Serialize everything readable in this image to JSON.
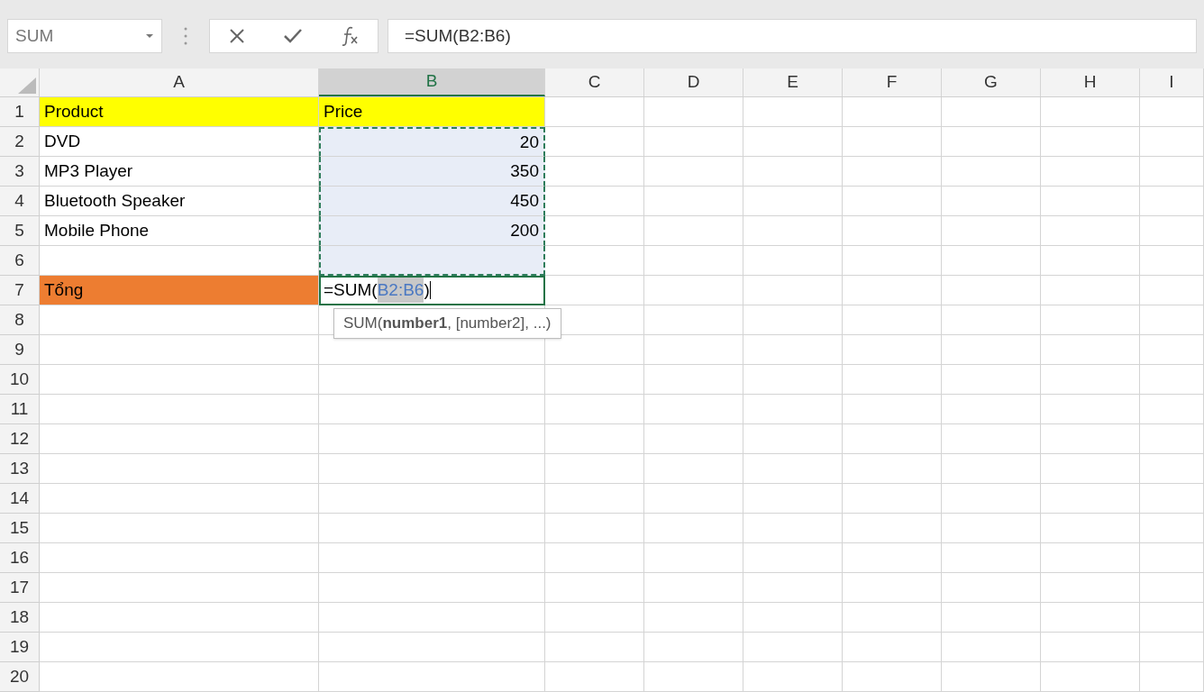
{
  "formula_bar": {
    "name_box": "SUM",
    "formula": "=SUM(B2:B6)"
  },
  "columns": [
    {
      "label": "A",
      "selected": false
    },
    {
      "label": "B",
      "selected": true
    },
    {
      "label": "C",
      "selected": false
    },
    {
      "label": "D",
      "selected": false
    },
    {
      "label": "E",
      "selected": false
    },
    {
      "label": "F",
      "selected": false
    },
    {
      "label": "G",
      "selected": false
    },
    {
      "label": "H",
      "selected": false
    },
    {
      "label": "I",
      "selected": false
    }
  ],
  "rows": [
    {
      "header": "1",
      "cells": [
        {
          "kind": "text",
          "text": "Product",
          "color": "#ffff00"
        },
        {
          "kind": "text",
          "text": "Price",
          "color": "#ffff00"
        }
      ]
    },
    {
      "header": "2",
      "cells": [
        {
          "kind": "text",
          "text": "DVD"
        },
        {
          "kind": "number",
          "text": "20",
          "in_range": true
        }
      ]
    },
    {
      "header": "3",
      "cells": [
        {
          "kind": "text",
          "text": "MP3 Player"
        },
        {
          "kind": "number",
          "text": "350",
          "in_range": true
        }
      ]
    },
    {
      "header": "4",
      "cells": [
        {
          "kind": "text",
          "text": "Bluetooth Speaker"
        },
        {
          "kind": "number",
          "text": "450",
          "in_range": true
        }
      ]
    },
    {
      "header": "5",
      "cells": [
        {
          "kind": "text",
          "text": "Mobile Phone"
        },
        {
          "kind": "number",
          "text": "200",
          "in_range": true
        }
      ]
    },
    {
      "header": "6",
      "cells": [
        {
          "kind": "text"
        },
        {
          "kind": "number",
          "in_range": true
        }
      ]
    },
    {
      "header": "7",
      "cells": [
        {
          "kind": "text",
          "text": "Tổng",
          "color": "#ed7d31"
        },
        {
          "kind": "formula",
          "active": true,
          "parts": [
            {
              "kind": "plain",
              "text": "=SUM("
            },
            {
              "kind": "ref",
              "text": "B2:B6"
            },
            {
              "kind": "plain",
              "text": ")"
            }
          ],
          "tooltip": "SUM(**number1**, [number2], ...)"
        }
      ]
    },
    {
      "header": "8"
    },
    {
      "header": "9"
    },
    {
      "header": "10"
    },
    {
      "header": "11"
    },
    {
      "header": "12"
    },
    {
      "header": "13"
    },
    {
      "header": "14"
    },
    {
      "header": "15"
    },
    {
      "header": "16"
    },
    {
      "header": "17"
    },
    {
      "header": "18"
    },
    {
      "header": "19"
    },
    {
      "header": "20"
    }
  ]
}
